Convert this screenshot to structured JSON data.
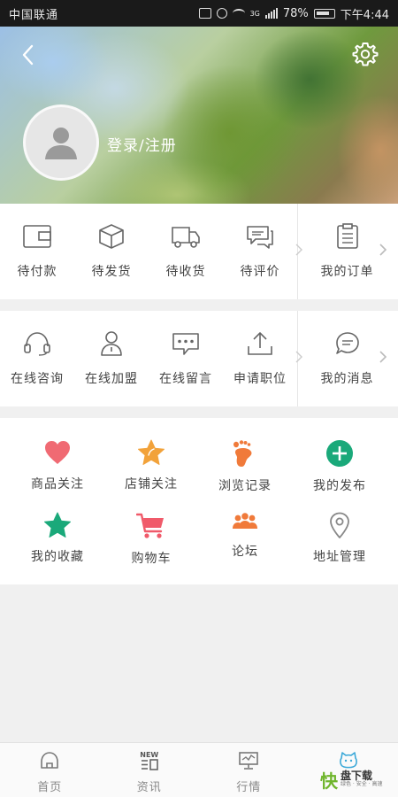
{
  "status_bar": {
    "carrier": "中国联通",
    "network": "3G",
    "battery": "78%",
    "time": "下午4:44"
  },
  "profile": {
    "login_text": "登录/注册"
  },
  "order_row": {
    "items": [
      {
        "label": "待付款",
        "icon": "wallet-icon"
      },
      {
        "label": "待发货",
        "icon": "package-icon"
      },
      {
        "label": "待收货",
        "icon": "truck-icon"
      },
      {
        "label": "待评价",
        "icon": "comment-icon"
      }
    ],
    "more": {
      "label": "我的订单",
      "icon": "clipboard-icon"
    }
  },
  "service_row": {
    "items": [
      {
        "label": "在线咨询",
        "icon": "headset-icon"
      },
      {
        "label": "在线加盟",
        "icon": "user-join-icon"
      },
      {
        "label": "在线留言",
        "icon": "message-dots-icon"
      },
      {
        "label": "申请职位",
        "icon": "upload-icon"
      }
    ],
    "more": {
      "label": "我的消息",
      "icon": "chat-bubble-icon"
    }
  },
  "feature_grid": {
    "items": [
      {
        "label": "商品关注",
        "icon": "heart-icon",
        "color": "#f06a73"
      },
      {
        "label": "店铺关注",
        "icon": "star-icon",
        "color": "#f2a23a"
      },
      {
        "label": "浏览记录",
        "icon": "footprint-icon",
        "color": "#f07a3a"
      },
      {
        "label": "我的发布",
        "icon": "plus-circle-icon",
        "color": "#1aa97a"
      },
      {
        "label": "我的收藏",
        "icon": "star-green-icon",
        "color": "#1aa97a"
      },
      {
        "label": "购物车",
        "icon": "cart-icon",
        "color": "#f05a6a"
      },
      {
        "label": "论坛",
        "icon": "group-icon",
        "color": "#f07a3a"
      },
      {
        "label": "地址管理",
        "icon": "location-pin-icon",
        "color": "#888888"
      }
    ]
  },
  "tab_bar": {
    "tabs": [
      {
        "label": "首页",
        "icon": "home-icon"
      },
      {
        "label": "资讯",
        "icon": "news-icon",
        "badge": "NEW"
      },
      {
        "label": "行情",
        "icon": "monitor-icon"
      },
      {
        "label": "",
        "icon": "profile-mascot-icon"
      }
    ]
  },
  "watermark": {
    "brand": "快",
    "text": "盘下载",
    "sub": "绿色 · 安全 · 高速"
  },
  "colors": {
    "header_overlay_text": "#ffffff",
    "label_text": "#444444",
    "tab_text": "#888888"
  }
}
